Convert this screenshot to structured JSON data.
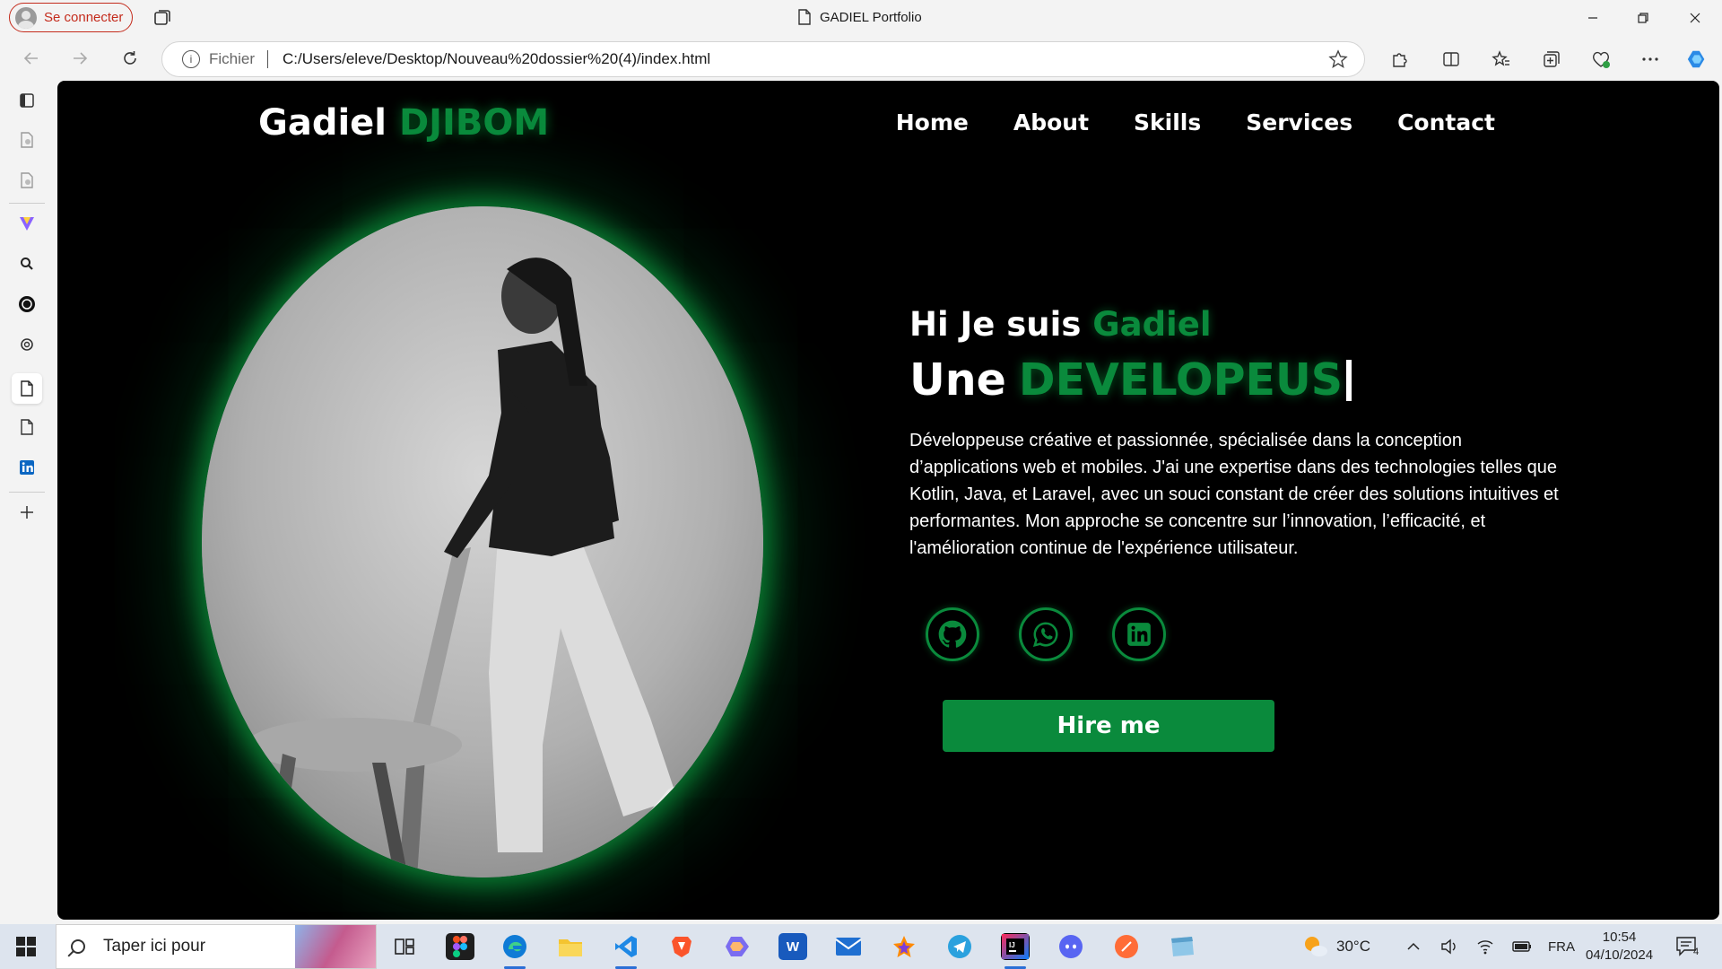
{
  "browser": {
    "signin_label": "Se connecter",
    "tab_title": "GADIEL Portfolio",
    "address_prefix": "Fichier",
    "url": "C:/Users/eleve/Desktop/Nouveau%20dossier%20(4)/index.html"
  },
  "site": {
    "logo_first": "Gadiel",
    "logo_second": "DJIBOM",
    "nav": [
      "Home",
      "About",
      "Skills",
      "Services",
      "Contact"
    ],
    "greeting": "Hi Je suis",
    "greeting_name": "Gadiel",
    "role_prefix": "Une",
    "role_word": "DEVELOPEUS",
    "description": "Développeuse créative et passionnée, spécialisée dans la conception d’applications web et mobiles. J'ai une expertise dans des technologies telles que Kotlin, Java, et Laravel, avec un souci constant de créer des solutions intuitives et performantes. Mon approche se concentre sur l’innovation, l’efficacité, et l'amélioration continue de l'expérience utilisateur.",
    "socials": [
      "github-icon",
      "whatsapp-icon",
      "linkedin-icon"
    ],
    "hire_label": "Hire me",
    "accent_color": "#0a8a3c"
  },
  "taskbar": {
    "search_placeholder": "Taper ici pour",
    "weather": "30°C",
    "language": "FRA",
    "time": "10:54",
    "date": "04/10/2024",
    "notification_count": "4"
  }
}
